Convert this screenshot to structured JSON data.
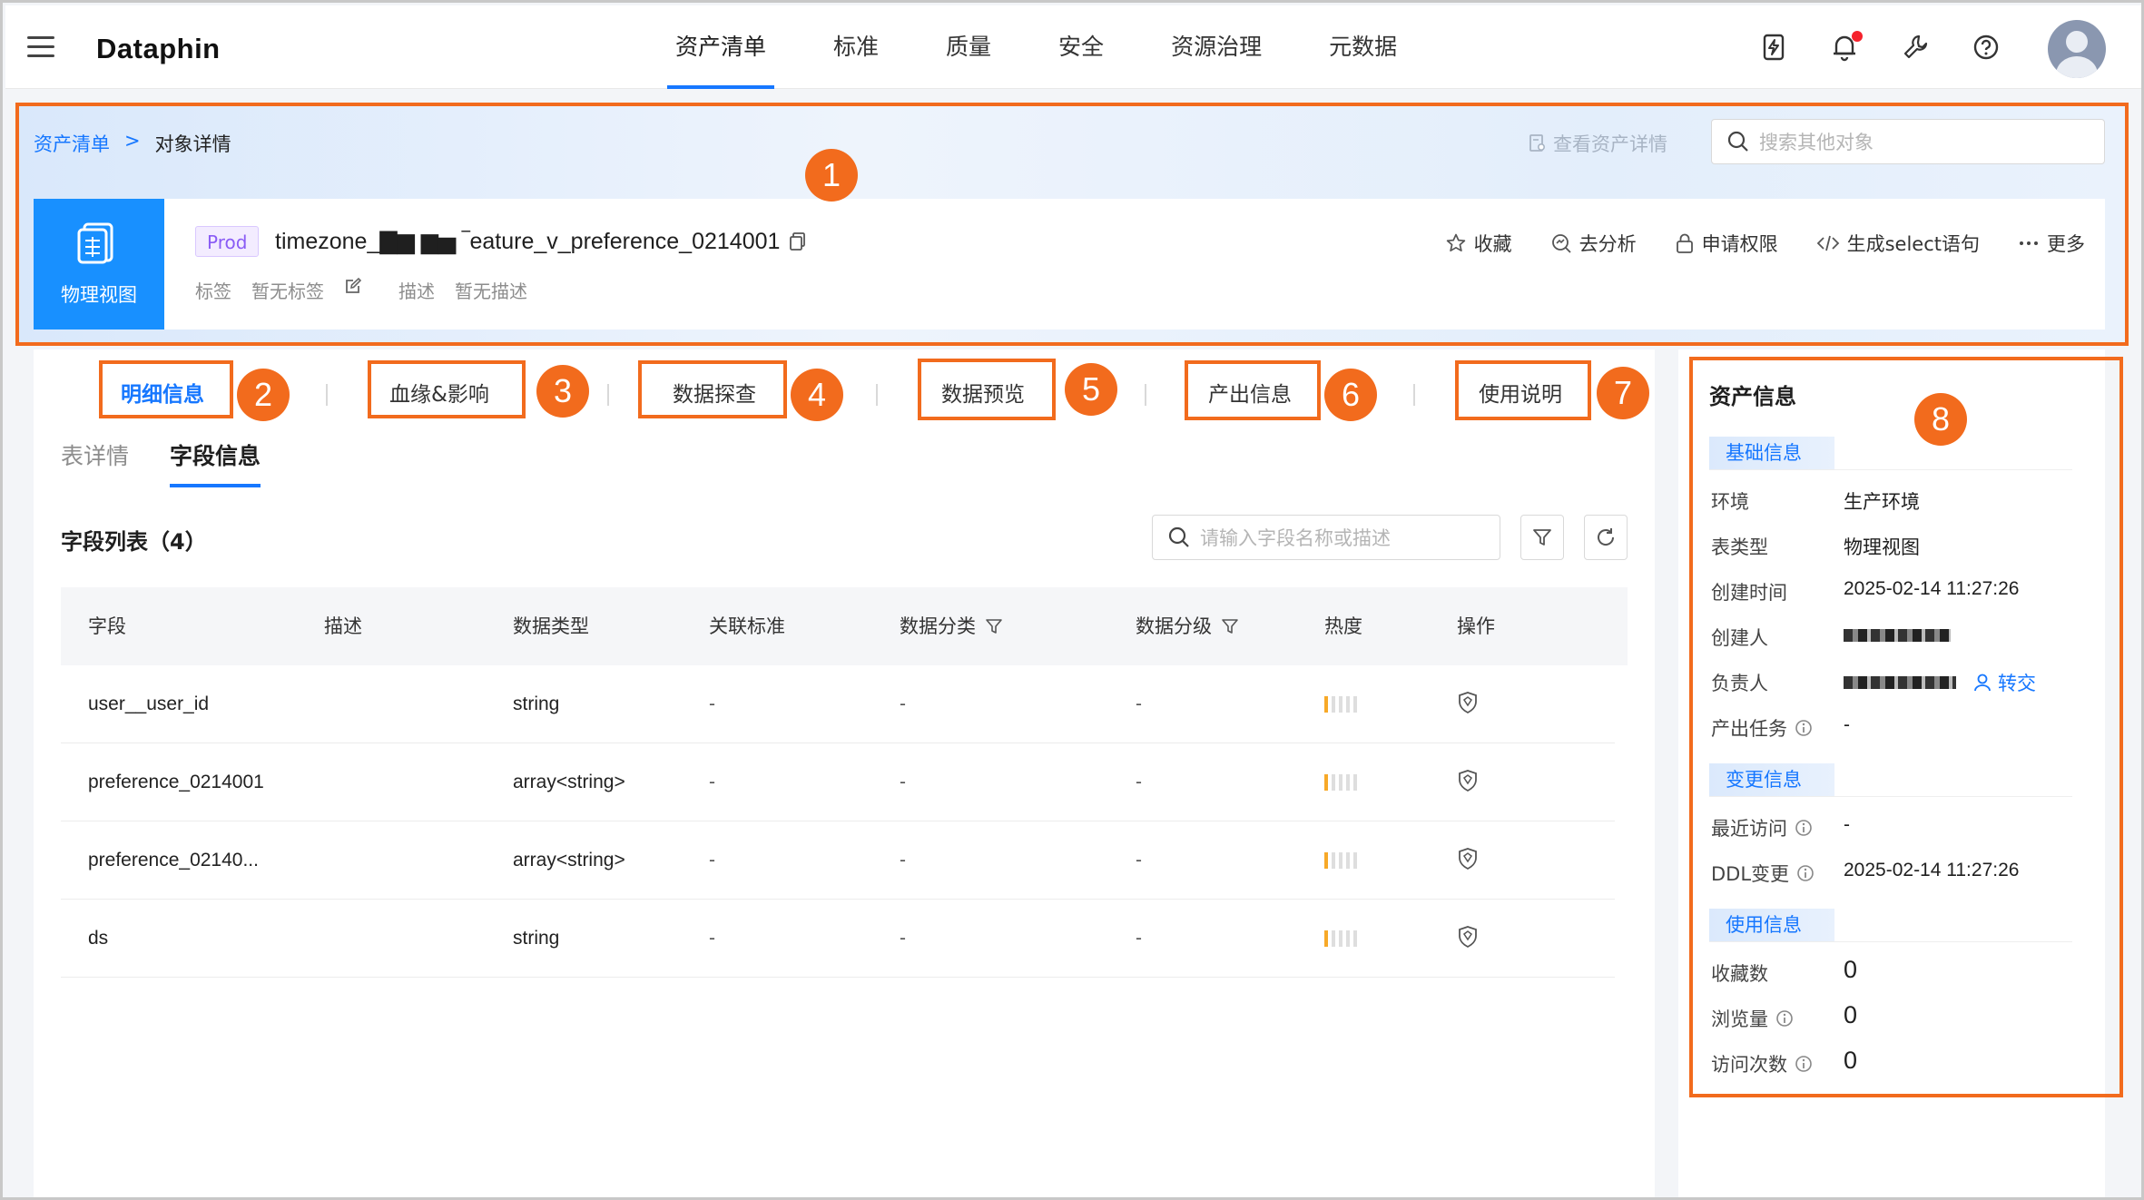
{
  "app": {
    "logo": "Dataphin"
  },
  "nav": {
    "items": [
      {
        "label": "资产清单",
        "active": true
      },
      {
        "label": "标准",
        "active": false
      },
      {
        "label": "质量",
        "active": false
      },
      {
        "label": "安全",
        "active": false
      },
      {
        "label": "资源治理",
        "active": false
      },
      {
        "label": "元数据",
        "active": false
      }
    ],
    "icons": [
      "lightning-doc-icon",
      "bell-icon",
      "wrench-icon",
      "help-icon"
    ]
  },
  "breadcrumb": {
    "root": "资产清单",
    "separator": ">",
    "current": "对象详情"
  },
  "header": {
    "view_detail": "查看资产详情",
    "search_placeholder": "搜索其他对象"
  },
  "object": {
    "type_label": "物理视图",
    "env_badge": "Prod",
    "name": "timezone_▇▆ ▆▅ ‾eature_v_preference_0214001",
    "tag_label": "标签",
    "tag_value": "暂无标签",
    "desc_label": "描述",
    "desc_value": "暂无描述",
    "actions": [
      "收藏",
      "去分析",
      "申请权限",
      "生成select语句",
      "更多"
    ]
  },
  "tabs": [
    "明细信息",
    "血缘&影响",
    "数据探查",
    "数据预览",
    "产出信息",
    "使用说明"
  ],
  "subtabs": [
    "表详情",
    "字段信息"
  ],
  "fields": {
    "title": "字段列表（4）",
    "search_placeholder": "请输入字段名称或描述",
    "columns": [
      "字段",
      "描述",
      "数据类型",
      "关联标准",
      "数据分类",
      "数据分级",
      "热度",
      "操作"
    ],
    "rows": [
      {
        "name": "user__user_id",
        "desc": "",
        "type": "string",
        "standard": "-",
        "category": "-",
        "level": "-"
      },
      {
        "name": "preference_0214001",
        "desc": "",
        "type": "array<string>",
        "standard": "-",
        "category": "-",
        "level": "-"
      },
      {
        "name": "preference_02140...",
        "desc": "",
        "type": "array<string>",
        "standard": "-",
        "category": "-",
        "level": "-"
      },
      {
        "name": "ds",
        "desc": "",
        "type": "string",
        "standard": "-",
        "category": "-",
        "level": "-"
      }
    ]
  },
  "asset_info": {
    "title": "资产信息",
    "sections": {
      "basic": "基础信息",
      "change": "变更信息",
      "usage": "使用信息"
    },
    "basic": {
      "env_k": "环境",
      "env_v": "生产环境",
      "type_k": "表类型",
      "type_v": "物理视图",
      "created_k": "创建时间",
      "created_v": "2025-02-14 11:27:26",
      "creator_k": "创建人",
      "owner_k": "负责人",
      "transfer": "转交",
      "task_k": "产出任务",
      "task_v": "-"
    },
    "change": {
      "visit_k": "最近访问",
      "visit_v": "-",
      "ddl_k": "DDL变更",
      "ddl_v": "2025-02-14 11:27:26"
    },
    "usage": {
      "fav_k": "收藏数",
      "fav_v": "0",
      "view_k": "浏览量",
      "view_v": "0",
      "access_k": "访问次数",
      "access_v": "0"
    }
  },
  "annotations": [
    "1",
    "2",
    "3",
    "4",
    "5",
    "6",
    "7",
    "8"
  ],
  "colors": {
    "accent": "#1677ff",
    "annotation": "#f26b1d",
    "prod_badge": "#8a5cf5",
    "heat": "#f7a928"
  }
}
